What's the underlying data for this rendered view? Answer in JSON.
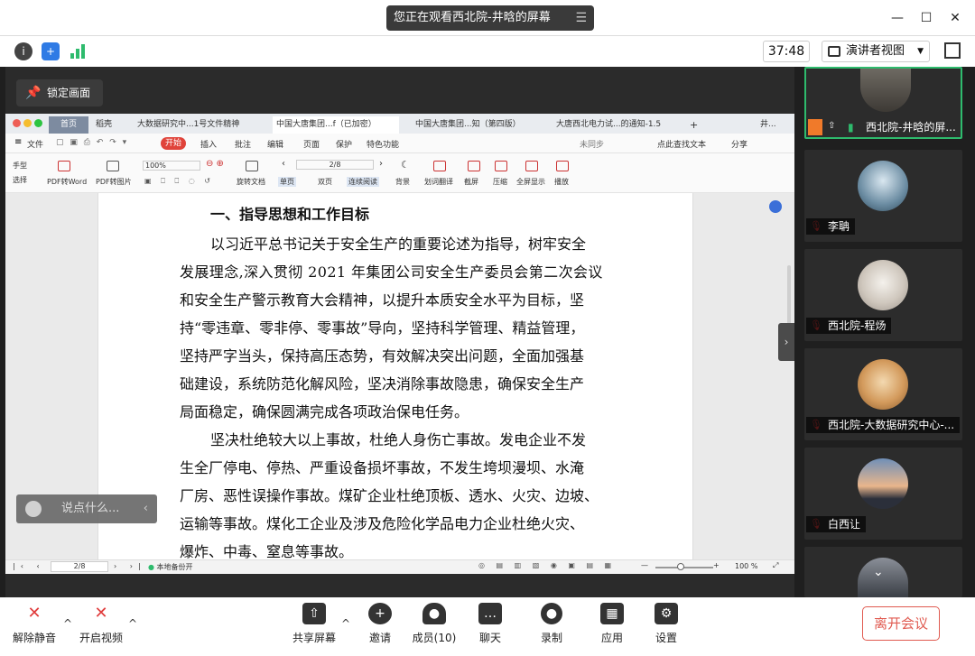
{
  "title_bar": {
    "share_notice": "您正在观看西北院-井晗的屏幕",
    "menu_icon": "list-icon",
    "window_controls": [
      "minimize",
      "maximize",
      "close"
    ]
  },
  "top_row": {
    "info_icon": "info-icon",
    "shield_icon": "shield-icon",
    "signal_icon": "signal-icon",
    "timer": "37:48",
    "view_button": "演讲者视图",
    "fullscreen_icon": "fullscreen-icon"
  },
  "viewer": {
    "lock_label": "锁定画面",
    "comment_placeholder": "说点什么...",
    "comment_arrow": "‹",
    "collapse_arrow": "›"
  },
  "wps": {
    "tabs": [
      {
        "label": "首页"
      },
      {
        "label": "稻壳"
      },
      {
        "label": "大数据研究中...1号文件精神"
      },
      {
        "label": "中国大唐集团...f（已加密）"
      },
      {
        "label": "中国大唐集团...知（第四版）"
      },
      {
        "label": "大唐西北电力试...的通知-1.5"
      },
      {
        "label": "+"
      },
      {
        "label": "井..."
      }
    ],
    "menu": [
      "文件",
      "开始",
      "插入",
      "批注",
      "编辑",
      "页面",
      "保护",
      "特色功能"
    ],
    "menu_right": [
      "未同步",
      "点此查找文本",
      "分享"
    ],
    "tools": [
      "手型",
      "选择",
      "PDF转Word",
      "PDF转图片",
      "100%",
      "旋转文档",
      "2/8",
      "单页",
      "双页",
      "连续阅读",
      "背景",
      "划词翻译",
      "截屏",
      "压缩",
      "全屏显示",
      "播放"
    ],
    "document": {
      "heading": "一、指导思想和工作目标",
      "lines": [
        "以习近平总书记关于安全生产的重要论述为指导，树牢安全",
        "发展理念,深入贯彻 2021 年集团公司安全生产委员会第二次会议",
        "和安全生产警示教育大会精神，以提升本质安全水平为目标，坚",
        "持“零违章、零非停、零事故”导向，坚持科学管理、精益管理，",
        "坚持严字当头，保持高压态势，有效解决突出问题，全面加强基",
        "础建设，系统防范化解风险，坚决消除事故隐患，确保安全生产",
        "局面稳定，确保圆满完成各项政治保电任务。",
        "坚决杜绝较大以上事故，杜绝人身伤亡事故。发电企业不发",
        "生全厂停电、停热、严重设备损坏事故，不发生垮坝漫坝、水淹",
        "厂房、恶性误操作事故。煤矿企业杜绝顶板、透水、火灾、边坡、",
        "运输等事故。煤化工企业及涉及危险化学品电力企业杜绝火灾、",
        "爆炸、中毒、窒息等事故。"
      ]
    },
    "status": {
      "page": "2/8",
      "backup": "本地备份开",
      "zoom": "100 %"
    }
  },
  "participants": [
    {
      "name": "西北院-井晗的屏...",
      "active": true
    },
    {
      "name": "李聃",
      "active": false
    },
    {
      "name": "西北院-程炀",
      "active": false
    },
    {
      "name": "西北院-大数据研究中心-...",
      "active": false
    },
    {
      "name": "白西让",
      "active": false
    }
  ],
  "bottom_bar": {
    "unmute": "解除静音",
    "start_video": "开启视频",
    "share_screen": "共享屏幕",
    "invite": "邀请",
    "members": "成员(10)",
    "chat": "聊天",
    "record": "录制",
    "apps": "应用",
    "settings": "设置",
    "leave": "离开会议"
  },
  "colors": {
    "accent_green": "#2ebb6d",
    "leave_red": "#e05a50",
    "wps_red": "#e0433a"
  }
}
